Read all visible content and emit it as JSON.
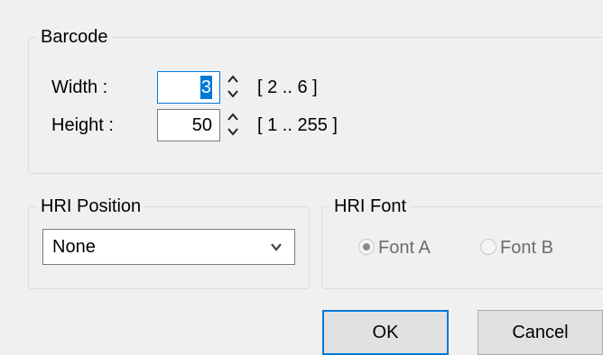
{
  "barcode": {
    "title": "Barcode",
    "width": {
      "label": "Width :",
      "value": "3",
      "range": "[ 2 .. 6 ]"
    },
    "height": {
      "label": "Height :",
      "value": "50",
      "range": "[ 1 .. 255 ]"
    }
  },
  "hri_position": {
    "title": "HRI Position",
    "selected": "None"
  },
  "hri_font": {
    "title": "HRI Font",
    "options": [
      {
        "label": "Font A",
        "checked": true,
        "enabled": false
      },
      {
        "label": "Font B",
        "checked": false,
        "enabled": false
      }
    ]
  },
  "buttons": {
    "ok": "OK",
    "cancel": "Cancel"
  },
  "colors": {
    "dialog_bg": "#f0f0f0",
    "focus_accent": "#0078d7",
    "disabled_text": "#6d6d6d"
  }
}
